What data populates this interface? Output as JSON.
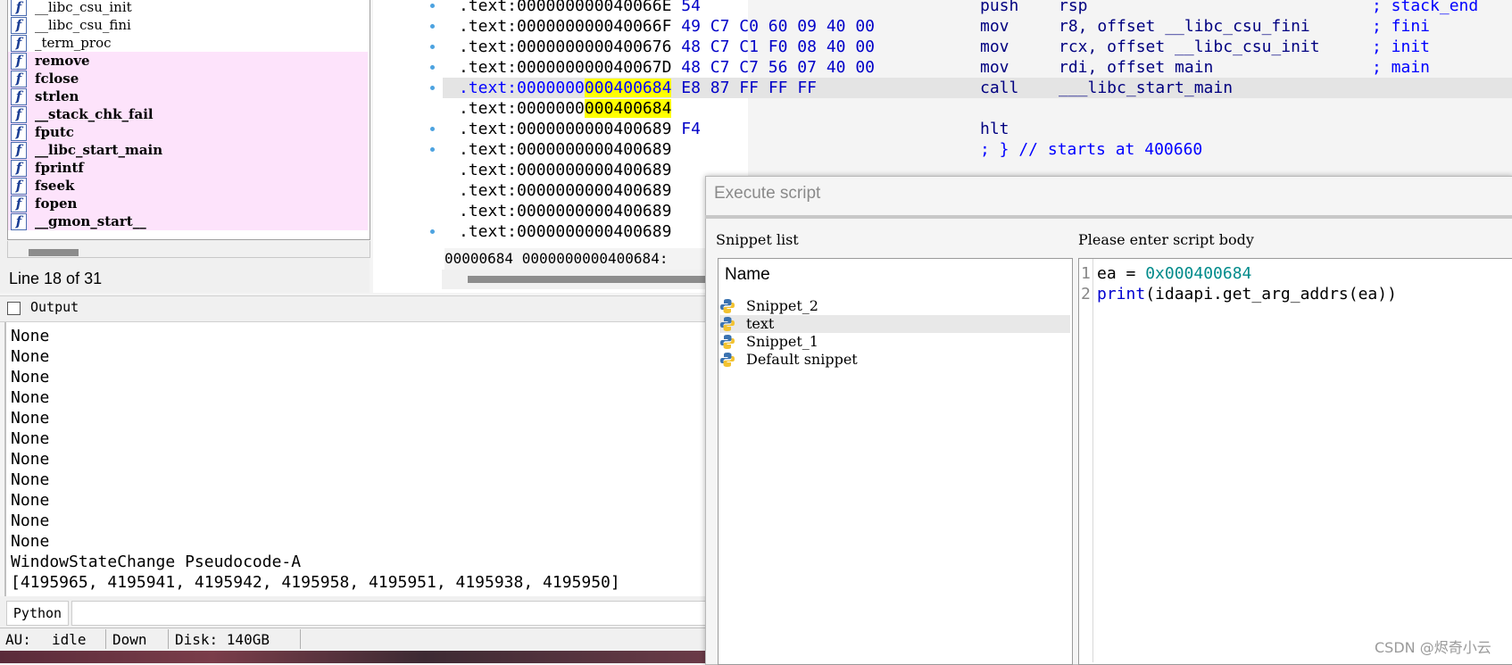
{
  "functions": {
    "items": [
      {
        "name": "__libc_csu_init",
        "imported": false
      },
      {
        "name": "__libc_csu_fini",
        "imported": false
      },
      {
        "name": "_term_proc",
        "imported": false
      },
      {
        "name": "remove",
        "imported": true
      },
      {
        "name": "fclose",
        "imported": true
      },
      {
        "name": "strlen",
        "imported": true
      },
      {
        "name": "__stack_chk_fail",
        "imported": true
      },
      {
        "name": "fputc",
        "imported": true
      },
      {
        "name": "__libc_start_main",
        "imported": true
      },
      {
        "name": "fprintf",
        "imported": true
      },
      {
        "name": "fseek",
        "imported": true
      },
      {
        "name": "fopen",
        "imported": true
      },
      {
        "name": "__gmon_start__",
        "imported": true
      }
    ],
    "icon": "function-f-icon",
    "line_info": "Line 18 of 31"
  },
  "disasm": {
    "lines": [
      {
        "addr": ".text:000000000040066E",
        "bytes": "54",
        "mnem": "push",
        "oper": "rsp",
        "cmt": "; stack_end"
      },
      {
        "addr": ".text:000000000040066F",
        "bytes": "49 C7 C0 60 09 40 00",
        "mnem": "mov",
        "oper": "r8, offset __libc_csu_fini",
        "cmt": "; fini"
      },
      {
        "addr": ".text:0000000000400676",
        "bytes": "48 C7 C1 F0 08 40 00",
        "mnem": "mov",
        "oper": "rcx, offset __libc_csu_init",
        "cmt": "; init"
      },
      {
        "addr": ".text:000000000040067D",
        "bytes": "48 C7 C7 56 07 40 00",
        "mnem": "mov",
        "oper": "rdi, offset main",
        "cmt": "; main"
      },
      {
        "addr_prefix": ".text:0000000",
        "addr_hl": "000400684",
        "bytes": "E8 87 FF FF FF",
        "mnem": "call",
        "oper": "___libc_start_main",
        "cmt": ""
      },
      {
        "addr_prefix": ".text:0000000",
        "addr_hl": "000400684",
        "bytes": "",
        "mnem": "",
        "oper": "",
        "cmt": ""
      },
      {
        "addr": ".text:0000000000400689",
        "bytes": "F4",
        "mnem": "hlt",
        "oper": "",
        "cmt": ""
      },
      {
        "addr": ".text:0000000000400689",
        "bytes": "",
        "mnem": "; } // starts at 400660",
        "oper": "",
        "cmt": ""
      },
      {
        "addr": ".text:0000000000400689",
        "bytes": "",
        "mnem": "",
        "oper": "",
        "cmt": ""
      },
      {
        "addr": ".text:0000000000400689",
        "bytes": "",
        "mnem": "",
        "oper": "",
        "cmt": ""
      },
      {
        "addr": ".text:0000000000400689",
        "bytes": "",
        "mnem": "",
        "oper": "",
        "cmt": ""
      },
      {
        "addr": ".text:0000000000400689",
        "bytes": "",
        "mnem": "",
        "oper": "",
        "cmt": ""
      }
    ],
    "status": "00000684 0000000000400684:"
  },
  "output": {
    "title": "Output",
    "lines": [
      "None",
      "None",
      "None",
      "None",
      "None",
      "None",
      "None",
      "None",
      "None",
      "None",
      "None",
      "WindowStateChange Pseudocode-A",
      "[4195965, 4195941, 4195942, 4195958, 4195951, 4195938, 4195950]"
    ],
    "python_label": "Python"
  },
  "statusbar": {
    "au_label": "AU:",
    "au_state": "idle",
    "direction": "Down",
    "disk": "Disk: 140GB"
  },
  "dialog": {
    "title": "Execute script",
    "snippet_list_label": "Snippet list",
    "script_body_label": "Please enter script body",
    "column_header": "Name",
    "snippets": [
      "Snippet_2",
      "text",
      "Snippet_1",
      "Default snippet"
    ],
    "selected_snippet": "text",
    "code": {
      "line1_var": "ea = ",
      "line1_hex": "0x000400684",
      "line2_kw": "print",
      "line2_rest": "(idaapi.get_arg_addrs(ea))"
    },
    "line_numbers": [
      "1",
      "2"
    ]
  },
  "watermark": "CSDN @烬奇小云",
  "colors": {
    "imported_bg": "#fde3fb",
    "highlight_yellow": "#ffff00",
    "address_blue": "#0000ff",
    "hex_teal": "#008b8b"
  }
}
